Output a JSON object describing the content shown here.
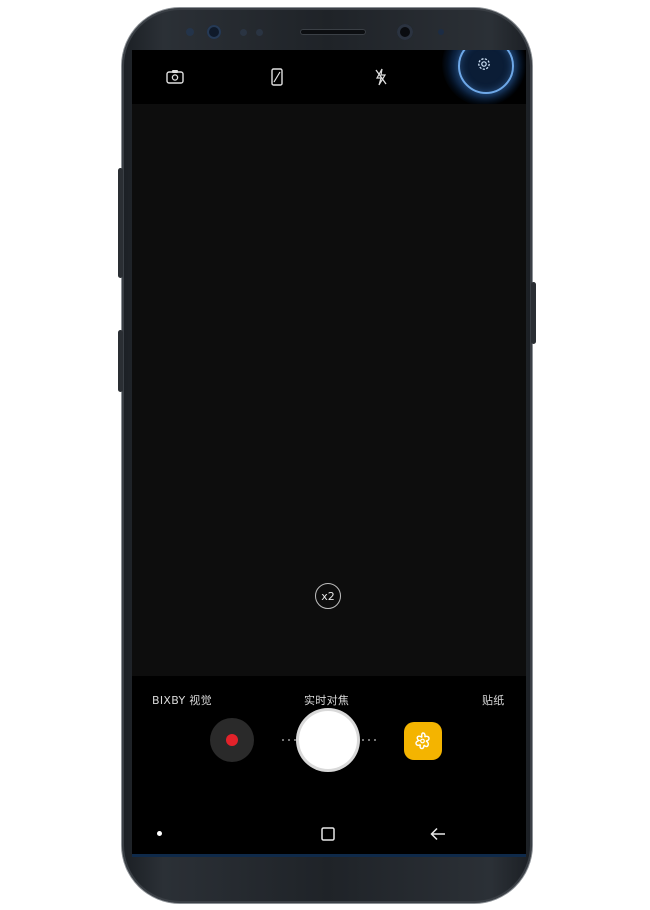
{
  "top_bar": {
    "icons": [
      "switch-camera-icon",
      "aspect-ratio-icon",
      "flash-off-icon",
      "settings-icon"
    ],
    "highlight_color": "#6ea8e8"
  },
  "viewfinder": {
    "zoom_label": "x2"
  },
  "modes": {
    "left": "BIXBY 视觉",
    "center": "实时对焦",
    "right": "贴纸"
  },
  "controls": {
    "record_color": "#e3222a",
    "sticker_color": "#f4b400"
  },
  "navigation": {
    "icons": [
      "recent-dot-icon",
      "home-square-icon",
      "back-arrow-icon"
    ]
  }
}
